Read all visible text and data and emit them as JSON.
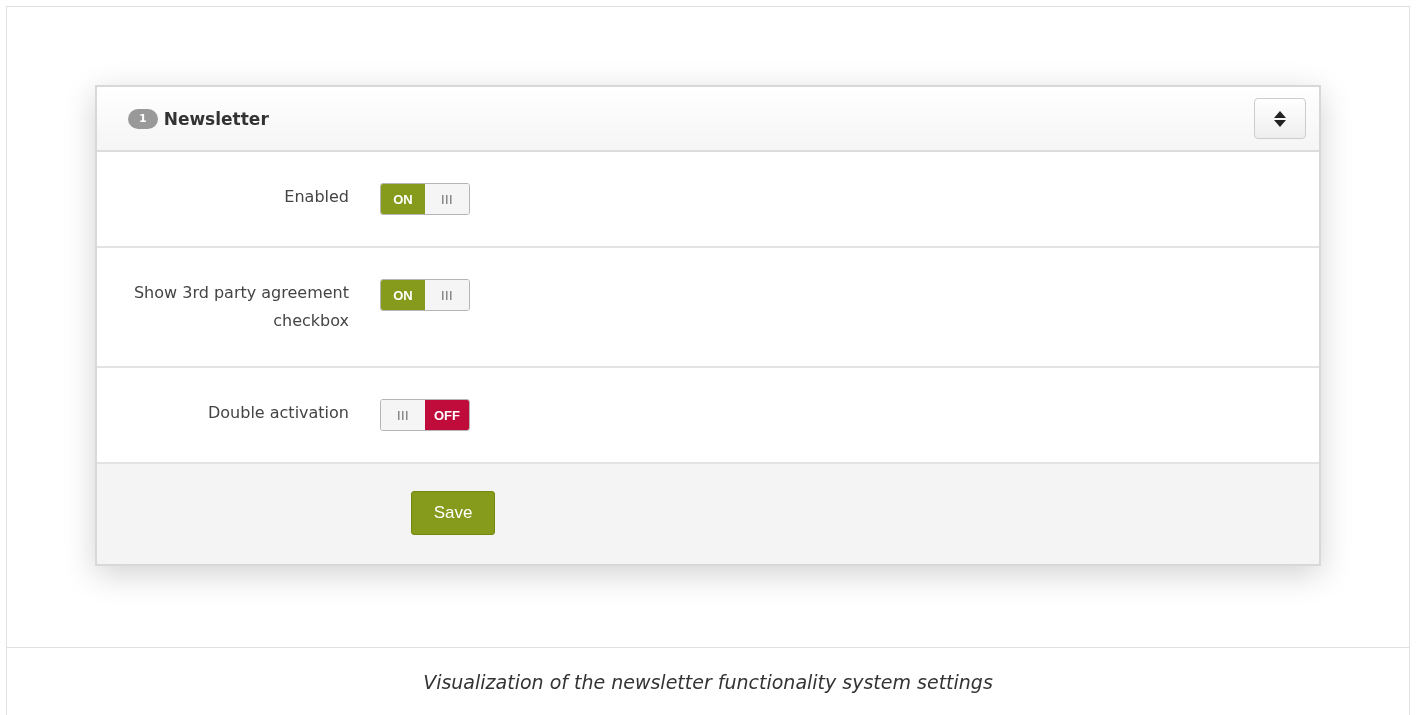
{
  "panel": {
    "badge": "1",
    "title": "Newsletter"
  },
  "settings": [
    {
      "label": "Enabled",
      "on": true,
      "state_label": "ON"
    },
    {
      "label": "Show 3rd party agreement checkbox",
      "on": true,
      "state_label": "ON"
    },
    {
      "label": "Double activation",
      "on": false,
      "state_label": "OFF"
    }
  ],
  "save_button": "Save",
  "caption": "Visualization of the newsletter functionality system settings"
}
